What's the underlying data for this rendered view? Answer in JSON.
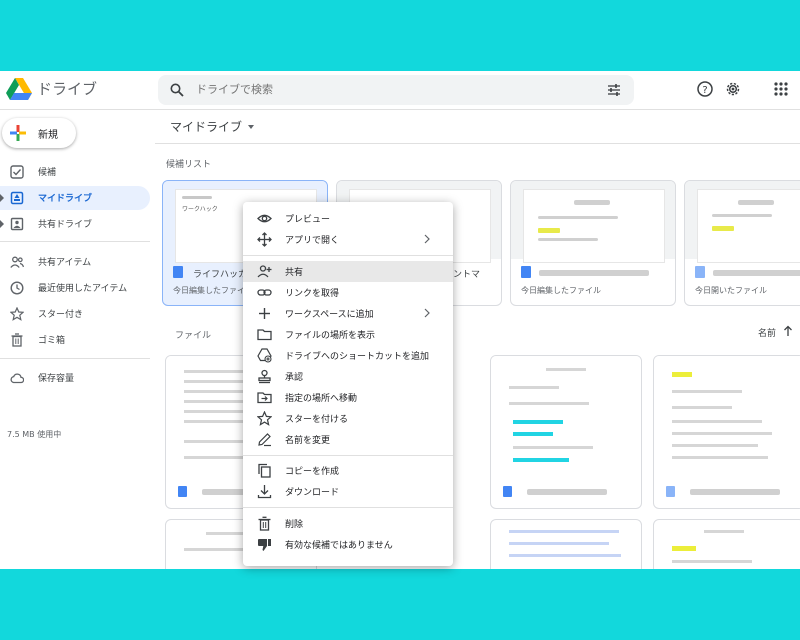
{
  "app": {
    "title": "ドライブ"
  },
  "search": {
    "placeholder": "ドライブで検索"
  },
  "sidebar": {
    "new_label": "新規",
    "items": [
      {
        "label": "候補",
        "icon": "check-square-icon"
      },
      {
        "label": "マイドライブ",
        "icon": "my-drive-icon",
        "active": true
      },
      {
        "label": "共有ドライブ",
        "icon": "shared-drives-icon"
      },
      {
        "label": "共有アイテム",
        "icon": "people-icon"
      },
      {
        "label": "最近使用したアイテム",
        "icon": "clock-icon"
      },
      {
        "label": "スター付き",
        "icon": "star-icon"
      },
      {
        "label": "ゴミ箱",
        "icon": "trash-icon"
      },
      {
        "label": "保存容量",
        "icon": "cloud-icon"
      }
    ],
    "storage_used": "7.5 MB 使用中"
  },
  "main": {
    "breadcrumb": "マイドライブ",
    "suggested_title": "候補リスト",
    "files_title": "ファイル",
    "sort_label": "名前",
    "quick_access": [
      {
        "title": "ライフハッカ",
        "subtitle": "今日編集したファイ",
        "thumb_text": "ワークハック"
      },
      {
        "title": "ントマ",
        "subtitle": ""
      },
      {
        "title": "",
        "subtitle": "今日編集したファイル"
      },
      {
        "title": "",
        "subtitle": "今日開いたファイル"
      }
    ]
  },
  "context_menu": {
    "items": [
      {
        "label": "プレビュー",
        "icon": "eye-icon"
      },
      {
        "label": "アプリで開く",
        "icon": "open-with-icon",
        "submenu": true
      },
      {
        "label": "共有",
        "icon": "person-add-icon",
        "hover": true
      },
      {
        "label": "リンクを取得",
        "icon": "link-icon"
      },
      {
        "label": "ワークスペースに追加",
        "icon": "plus-icon",
        "submenu": true
      },
      {
        "label": "ファイルの場所を表示",
        "icon": "folder-icon"
      },
      {
        "label": "ドライブへのショートカットを追加",
        "icon": "add-shortcut-icon"
      },
      {
        "label": "承認",
        "icon": "stamp-icon"
      },
      {
        "label": "指定の場所へ移動",
        "icon": "move-to-icon"
      },
      {
        "label": "スターを付ける",
        "icon": "star-icon"
      },
      {
        "label": "名前を変更",
        "icon": "edit-icon"
      },
      {
        "label": "コピーを作成",
        "icon": "copy-icon"
      },
      {
        "label": "ダウンロード",
        "icon": "download-icon"
      },
      {
        "label": "削除",
        "icon": "trash-icon"
      },
      {
        "label": "有効な候補ではありません",
        "icon": "thumb-down-icon"
      }
    ]
  },
  "colors": {
    "background": "#12d8dc",
    "accent": "#1967d2",
    "selected_bg": "#e8f0fe"
  }
}
